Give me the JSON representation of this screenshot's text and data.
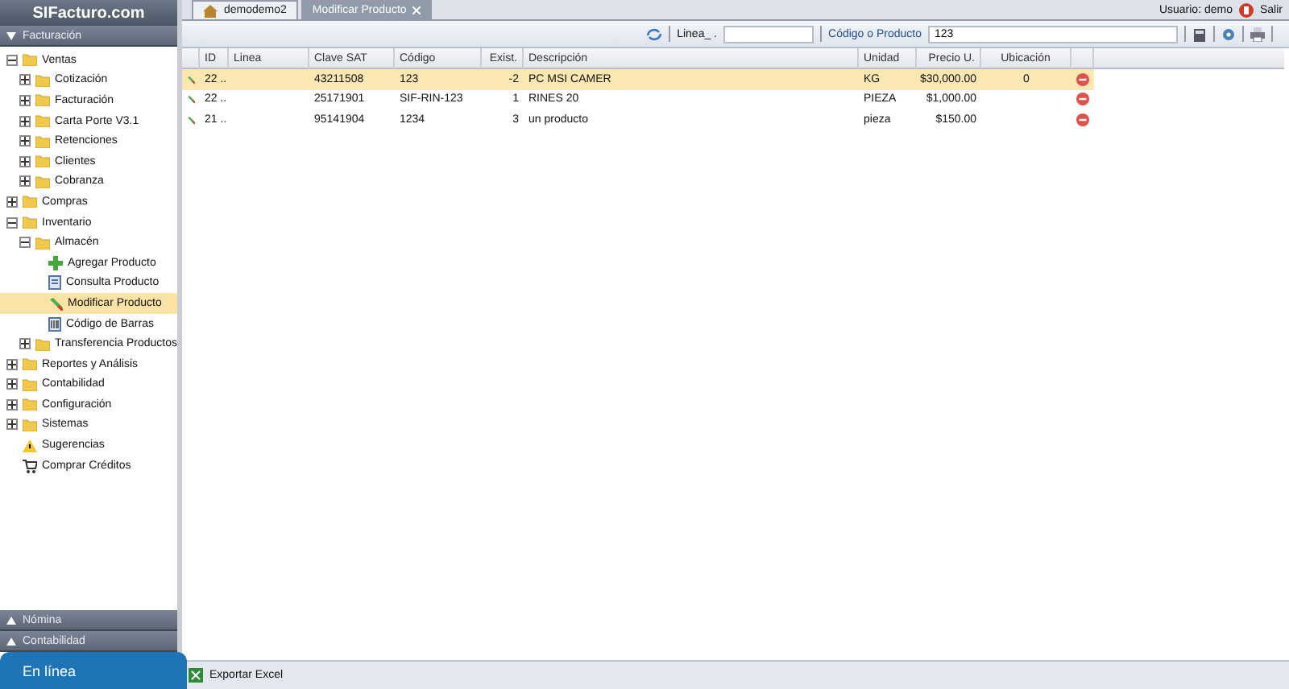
{
  "brand": "SIFacturo.com",
  "sidebar": {
    "title": "Facturación",
    "tree": [
      {
        "label": "Ventas",
        "kind": "folder",
        "expanded": true,
        "children": [
          {
            "label": "Cotización",
            "kind": "folder",
            "expanded": false
          },
          {
            "label": "Facturación",
            "kind": "folder",
            "expanded": false
          },
          {
            "label": "Carta Porte V3.1",
            "kind": "folder",
            "expanded": false
          },
          {
            "label": "Retenciones",
            "kind": "folder",
            "expanded": false
          },
          {
            "label": "Clientes",
            "kind": "folder",
            "expanded": false
          },
          {
            "label": "Cobranza",
            "kind": "folder",
            "expanded": false
          }
        ]
      },
      {
        "label": "Compras",
        "kind": "folder",
        "expanded": false
      },
      {
        "label": "Inventario",
        "kind": "folder",
        "expanded": true,
        "children": [
          {
            "label": "Almacén",
            "kind": "folder",
            "expanded": true,
            "children": [
              {
                "label": "Agregar Producto",
                "kind": "add",
                "selected": false
              },
              {
                "label": "Consulta Producto",
                "kind": "view",
                "selected": false
              },
              {
                "label": "Modificar Producto",
                "kind": "edit",
                "selected": true
              },
              {
                "label": "Código de Barras",
                "kind": "barcode",
                "selected": false
              }
            ]
          },
          {
            "label": "Transferencia Productos",
            "kind": "folder",
            "expanded": false
          }
        ]
      },
      {
        "label": "Reportes y Análisis",
        "kind": "folder",
        "expanded": false
      },
      {
        "label": "Contabilidad",
        "kind": "folder",
        "expanded": false
      },
      {
        "label": "Configuración",
        "kind": "folder",
        "expanded": false
      },
      {
        "label": "Sistemas",
        "kind": "folder",
        "expanded": false
      },
      {
        "label": "Sugerencias",
        "kind": "warning",
        "selected": false
      },
      {
        "label": "Comprar Créditos",
        "kind": "cart",
        "selected": false
      }
    ],
    "panels": [
      "Nómina",
      "Contabilidad"
    ],
    "status": "En línea"
  },
  "tabs": [
    {
      "label": "demodemo2",
      "selected": false,
      "closable": false
    },
    {
      "label": "Modificar Producto",
      "selected": true,
      "closable": true
    }
  ],
  "user": {
    "label": "Usuario: demo",
    "logout": "Salir"
  },
  "toolbar": {
    "linea_label": "Linea_ .",
    "code_label": "Código o Producto",
    "code_value": "123"
  },
  "table": {
    "columns": [
      "ID",
      "Linea",
      "Clave SAT",
      "Código",
      "Exist.",
      "Descripción",
      "Unidad",
      "Precio U.",
      "Ubicación"
    ],
    "rows": [
      {
        "selected": true,
        "cells": [
          "22 ..",
          "",
          "43211508",
          "123",
          "-2",
          "PC MSI CAMER",
          "KG",
          "$30,000.00",
          "0"
        ]
      },
      {
        "selected": false,
        "cells": [
          "22 ..",
          "",
          "25171901",
          "SIF-RIN-123",
          "1",
          "RINES 20",
          "PIEZA",
          "$1,000.00",
          ""
        ]
      },
      {
        "selected": false,
        "cells": [
          "21 ..",
          "",
          "95141904",
          "1234",
          "3",
          "un producto",
          "pieza",
          "$150.00",
          ""
        ]
      }
    ]
  },
  "footer": {
    "export": "Exportar Excel"
  }
}
